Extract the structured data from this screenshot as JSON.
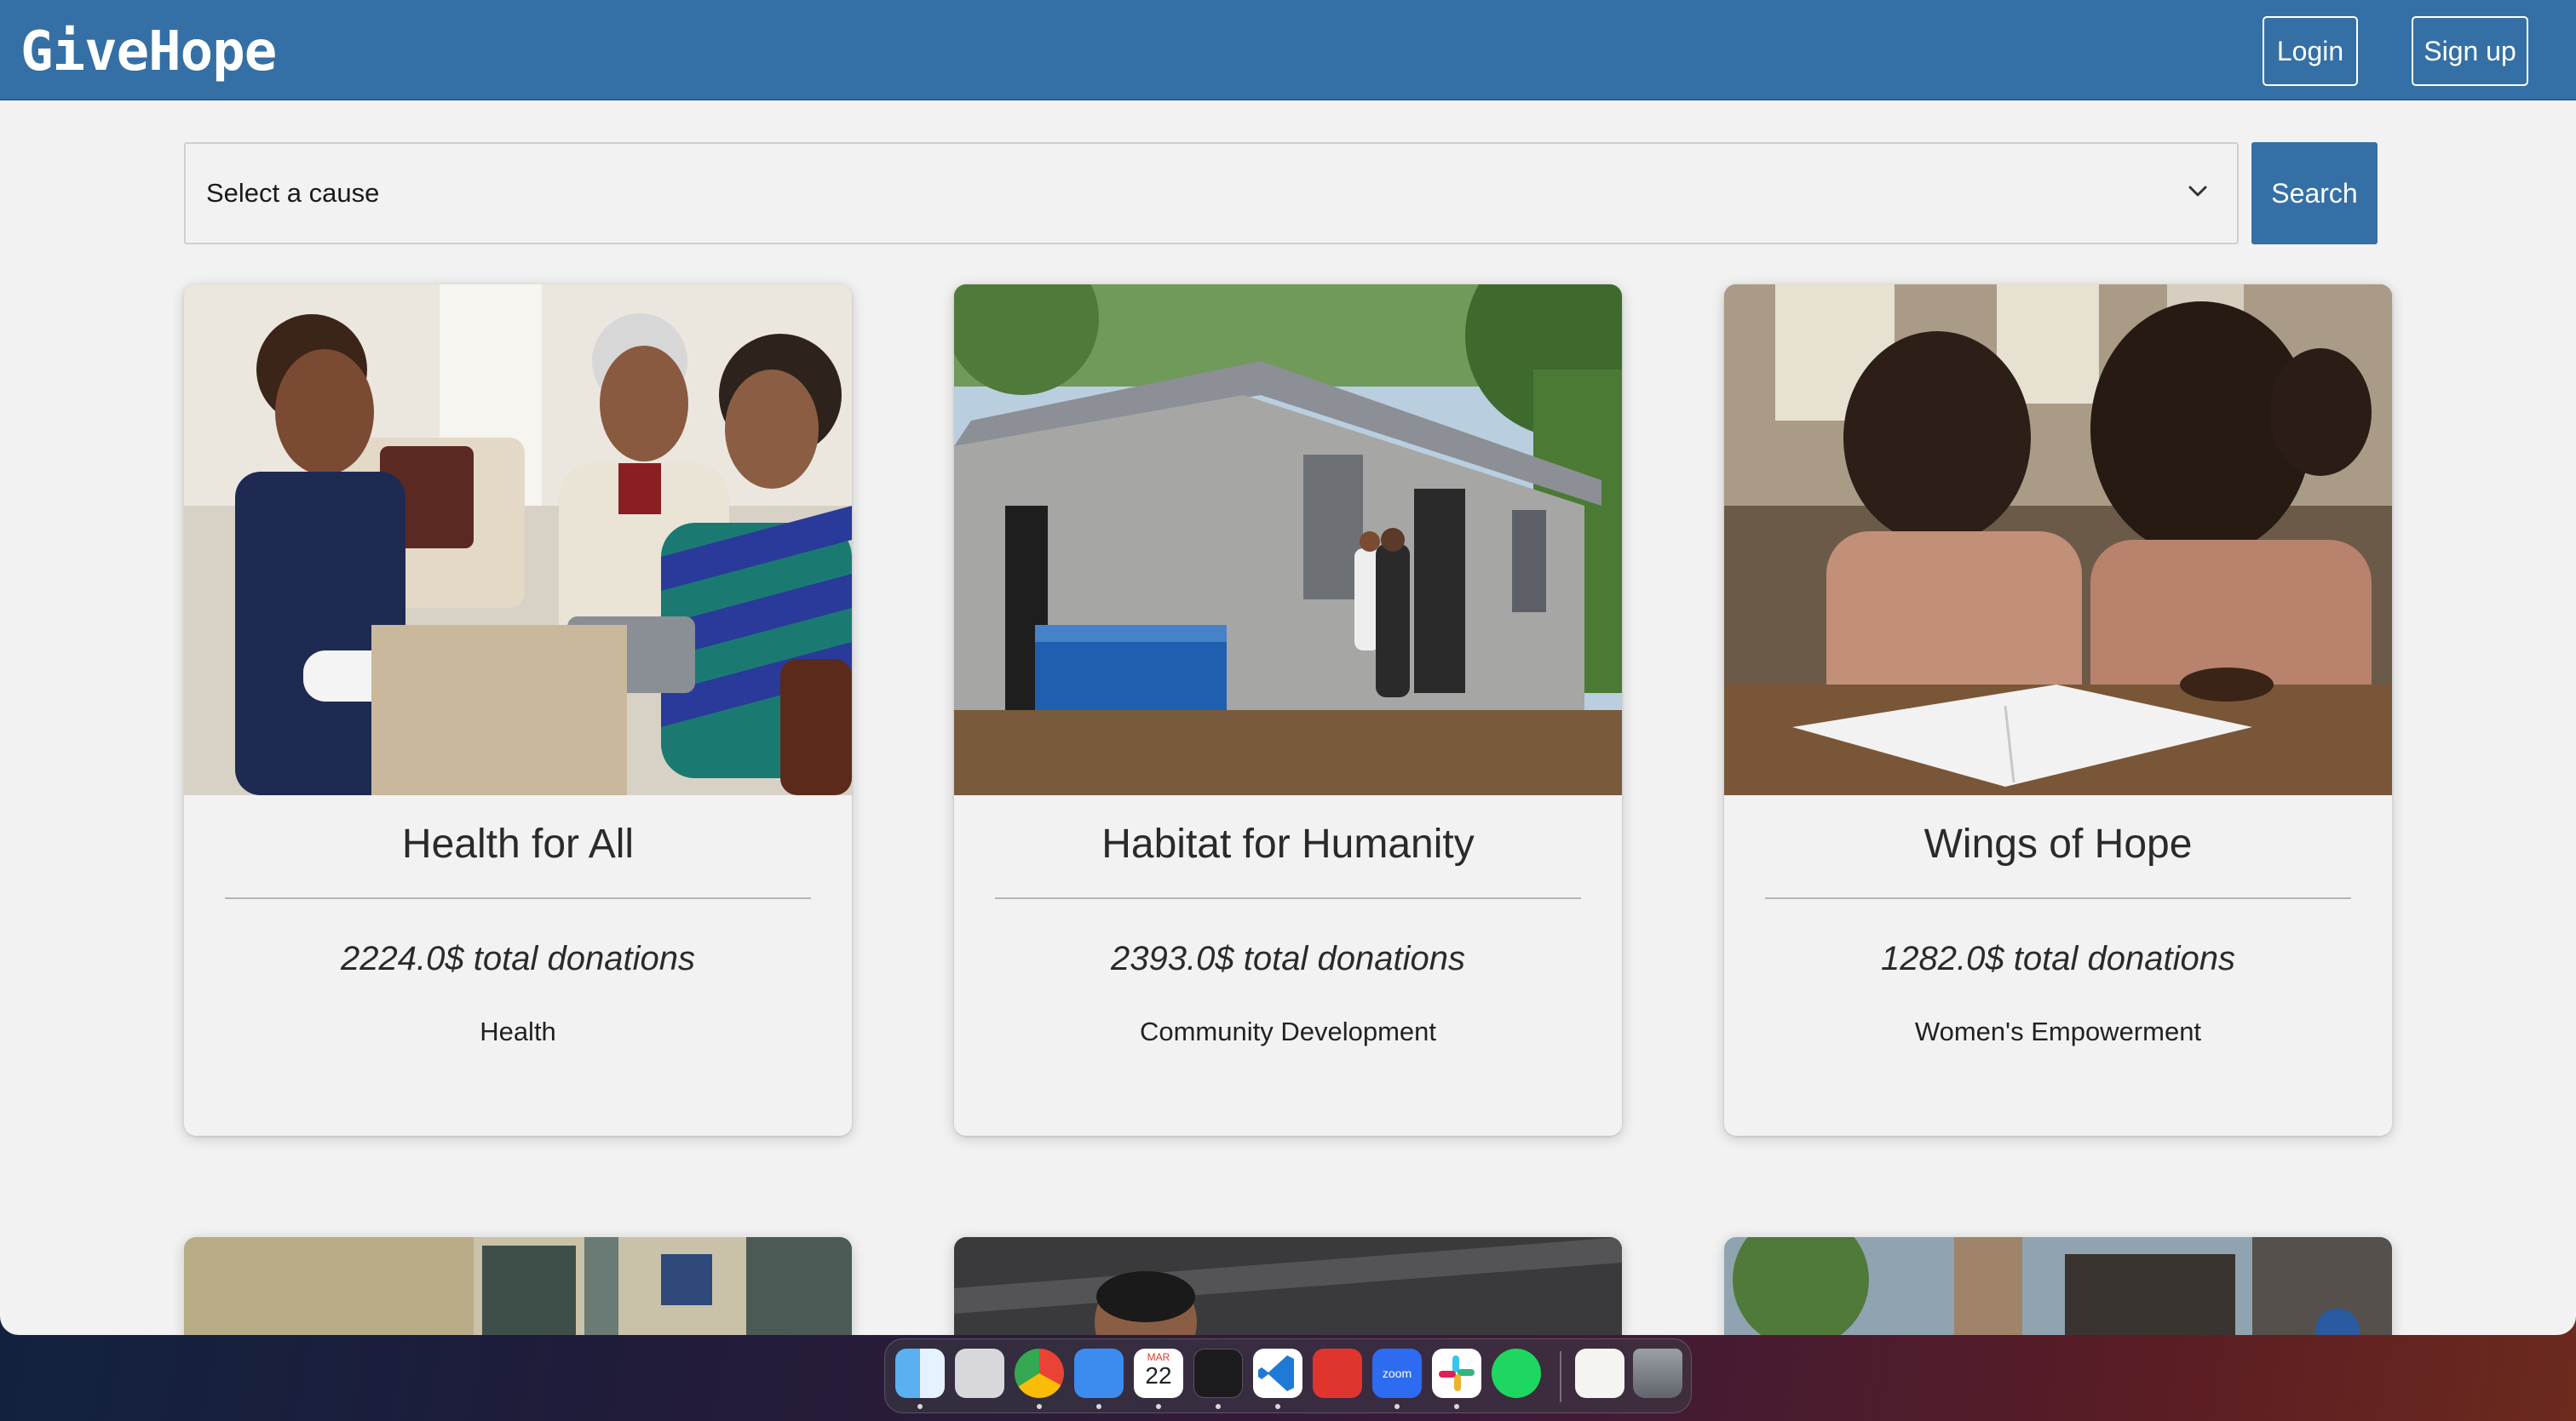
{
  "app": {
    "brand": "GiveHope"
  },
  "nav": {
    "login_label": "Login",
    "signup_label": "Sign up"
  },
  "filter": {
    "select_value": "Select a cause",
    "search_label": "Search"
  },
  "causes": [
    {
      "title": "Health for All",
      "total": "2224.0$ total donations",
      "category": "Health"
    },
    {
      "title": "Habitat for Humanity",
      "total": "2393.0$ total donations",
      "category": "Community Development"
    },
    {
      "title": "Wings of Hope",
      "total": "1282.0$ total donations",
      "category": "Women's Empowerment"
    }
  ],
  "dock": {
    "calendar_month": "MAR",
    "calendar_day": "22",
    "zoom_label": "zoom",
    "items": [
      "finder-icon",
      "launchpad-icon",
      "chrome-icon",
      "mail-icon",
      "calendar-icon",
      "terminal-icon",
      "vscode-icon",
      "bear-icon",
      "zoom-icon",
      "slack-icon",
      "spotify-icon",
      "document-icon",
      "trash-icon"
    ]
  },
  "colors": {
    "primary": "#3470a5",
    "background": "#f2f2f2",
    "text": "#2a2a2a"
  }
}
